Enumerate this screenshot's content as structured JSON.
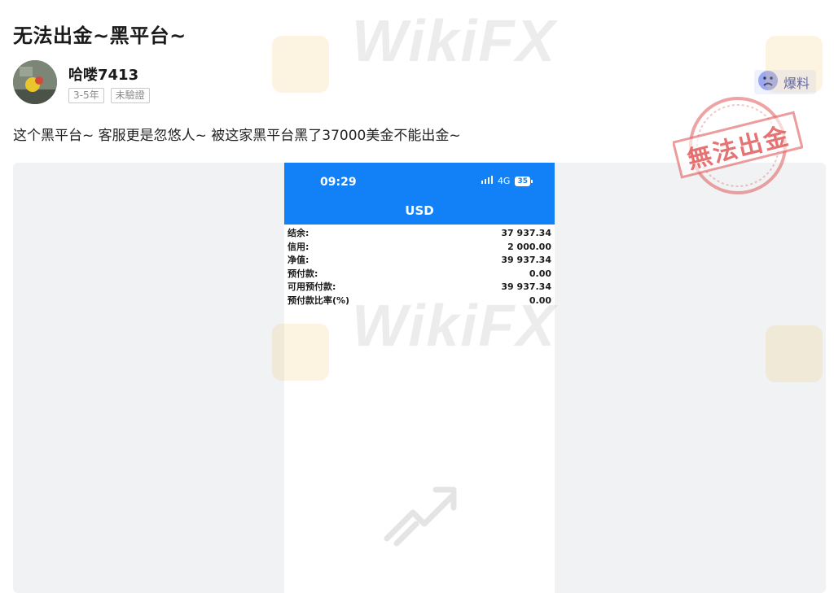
{
  "post": {
    "title": "无法出金~黑平台~",
    "body": "这个黑平台~ 客服更是忽悠人~ 被这家黑平台黑了37000美金不能出金~"
  },
  "author": {
    "name": "哈喽7413",
    "tags": [
      "3-5年",
      "未驗證"
    ]
  },
  "report": {
    "label": "爆料",
    "icon": "sad-face-icon"
  },
  "stamp": {
    "text": "無法出金",
    "color": "#e05a5a"
  },
  "watermark": {
    "text": "WikiFX"
  },
  "screenshot": {
    "time": "09:29",
    "network": "4G",
    "battery": "35",
    "currency": "USD",
    "accent": "#1281f7",
    "rows": [
      {
        "label": "结余:",
        "value": "37 937.34"
      },
      {
        "label": "信用:",
        "value": "2 000.00"
      },
      {
        "label": "净值:",
        "value": "39 937.34"
      },
      {
        "label": "预付款:",
        "value": "0.00"
      },
      {
        "label": "可用预付款:",
        "value": "39 937.34"
      },
      {
        "label": "预付款比率(%)",
        "value": "0.00"
      }
    ]
  }
}
